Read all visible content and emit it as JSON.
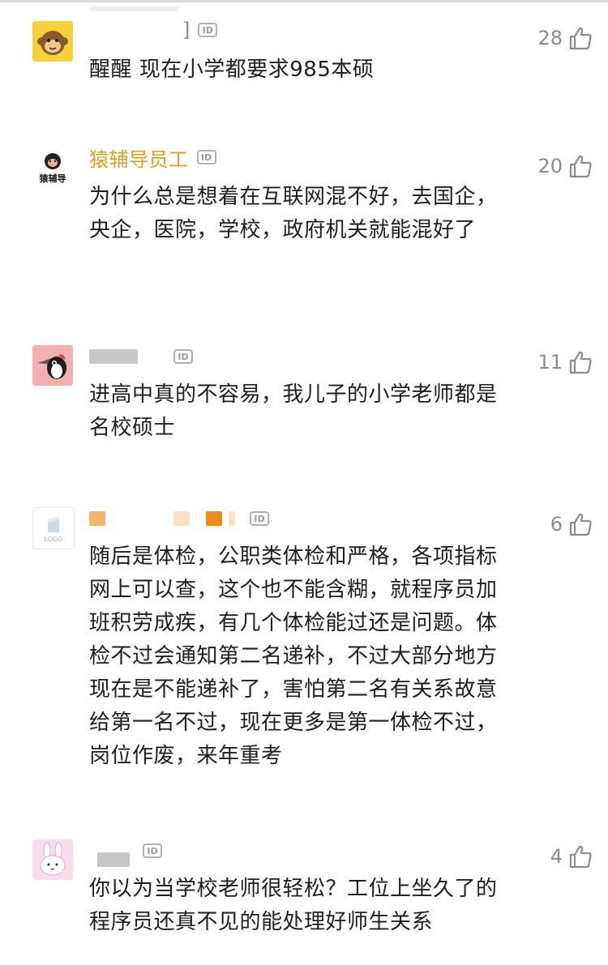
{
  "comments": [
    {
      "author": "",
      "author_hidden": true,
      "avatar_icon": "monkey-icon",
      "text": "醒醒 现在小学都要求985本硕",
      "likes": "28"
    },
    {
      "author": "猿辅导员工",
      "author_hidden": false,
      "avatar_icon": "yuanfudao-logo-icon",
      "avatar_label": "猿辅导",
      "text": "为什么总是想着在互联网混不好，去国企，央企，医院，学校，政府机关就能混好了",
      "likes": "20"
    },
    {
      "author": "",
      "author_hidden": true,
      "avatar_icon": "woodpecker-icon",
      "text": "进高中真的不容易，我儿子的小学老师都是名校硕士",
      "likes": "11"
    },
    {
      "author": "",
      "author_hidden": true,
      "avatar_icon": "logo-placeholder-icon",
      "avatar_label": "LOGO",
      "text": "随后是体检，公职类体检和严格，各项指标网上可以查，这个也不能含糊，就程序员加班积劳成疾，有几个体检能过还是问题。体检不过会通知第二名递补，不过大部分地方现在是不能递补了，害怕第二名有关系故意给第一名不过，现在更多是第一体检不过，岗位作废，来年重考",
      "likes": "6"
    },
    {
      "author": "",
      "author_hidden": true,
      "avatar_icon": "rabbit-icon",
      "text": "你以为当学校老师很轻松？工位上坐久了的程序员还真不见的能处理好师生关系",
      "likes": "4"
    }
  ],
  "id_badge_label": "ID",
  "bracket_char": "]",
  "colors": {
    "author_name": "#d4a02a",
    "like_gray": "#8c8c8c",
    "text": "#1e1e1e"
  }
}
